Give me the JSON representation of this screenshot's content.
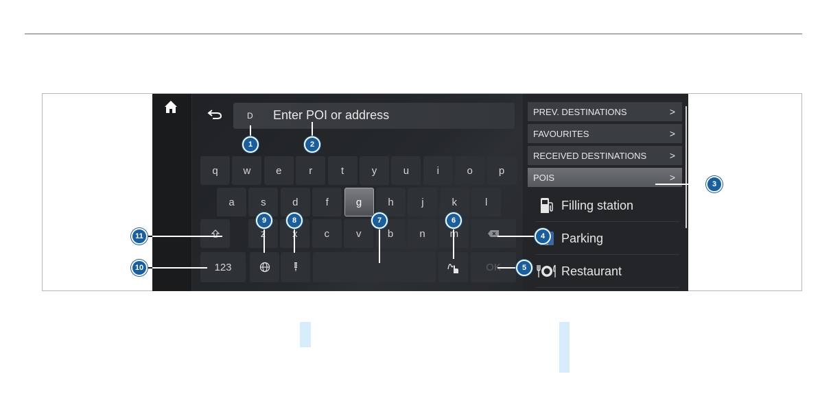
{
  "input": {
    "prefix": "D",
    "placeholder": "Enter POI or address"
  },
  "keyboard": {
    "row1": [
      "q",
      "w",
      "e",
      "r",
      "t",
      "y",
      "u",
      "i",
      "o",
      "p"
    ],
    "row2": [
      "a",
      "s",
      "d",
      "f",
      "g",
      "h",
      "j",
      "k",
      "l"
    ],
    "row3": [
      "z",
      "x",
      "c",
      "v",
      "b",
      "n",
      "m"
    ],
    "active_key": "g",
    "numbers_label": "123",
    "ok_label": "OK"
  },
  "sidebar": {
    "menu": [
      "PREV. DESTINATIONS",
      "FAVOURITES",
      "RECEIVED DESTINATIONS",
      "POIS"
    ],
    "selected": "POIS",
    "pois": [
      "Filling station",
      "Parking",
      "Restaurant"
    ]
  },
  "callouts": [
    "1",
    "2",
    "3",
    "4",
    "5",
    "6",
    "7",
    "8",
    "9",
    "10",
    "11"
  ],
  "icons": [
    "home-icon",
    "back-arrow-icon",
    "chevron-right-icon",
    "fuel-pump-icon",
    "parking-icon",
    "restaurant-icon",
    "shift-icon",
    "globe-icon",
    "microphone-icon",
    "handwriting-icon",
    "backspace-icon"
  ],
  "colors": {
    "callout": "#1a5e9b",
    "screen_bg": "#26292c",
    "key_bg": "#2e3135"
  }
}
